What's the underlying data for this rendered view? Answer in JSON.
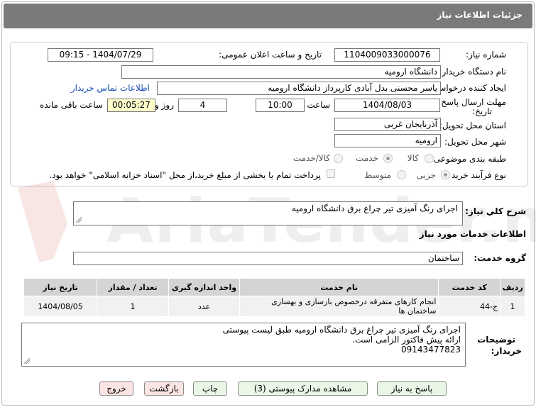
{
  "header": {
    "title": "جزئیات اطلاعات نیاز"
  },
  "form": {
    "need_number_label": "شماره نیاز:",
    "need_number": "1104009033000076",
    "announce_label": "تاریخ و ساعت اعلان عمومی:",
    "announce_value": "1404/07/29 - 09:15",
    "buyer_org_label": "نام دستگاه خریدار:",
    "buyer_org": "دانشگاه ارومیه",
    "creator_label": "ایجاد کننده درخواست:",
    "creator": "یاسر محسنی بدل آبادی کارپرداز دانشگاه ارومیه",
    "contact_link": "اطلاعات تماس خریدار",
    "deadline_label_1": "مهلت ارسال پاسخ: تا",
    "deadline_label_2": "تاریخ:",
    "deadline_date": "1404/08/03",
    "time_label": "ساعت",
    "deadline_time": "10:00",
    "days": "4",
    "days_label": "روز و",
    "remaining": "00:05:27",
    "remaining_label": "ساعت باقی مانده",
    "province_label": "استان محل تحویل:",
    "province": "آذربایجان غربی",
    "city_label": "شهر محل تحویل:",
    "city": "ارومیه",
    "category_label": "طبقه بندی موضوعی:",
    "category_options": [
      "کالا",
      "خدمت",
      "کالا/خدمت"
    ],
    "category_selected": "خدمت",
    "process_label": "نوع فرآیند خرید :",
    "process_options": [
      "جزیی",
      "متوسط"
    ],
    "process_selected": "جزیی",
    "payment_note": "پرداخت تمام یا بخشی از مبلغ خرید،از محل \"اسناد خزانه اسلامی\" خواهد بود."
  },
  "summary": {
    "label": "شرح كلي نياز:",
    "value": "اجرای رنگ آمیزی تیر چراغ برق دانشگاه ارومیه"
  },
  "services": {
    "section_title": "اطلاعات خدمات مورد نیاز",
    "group_label": "گروه خدمت:",
    "group_value": "ساختمان",
    "columns": [
      "ردیف",
      "کد خدمت",
      "نام خدمت",
      "واحد اندازه گیری",
      "تعداد / مقدار",
      "تاریخ نیاز"
    ],
    "rows": [
      {
        "row": "1",
        "code": "ج-44",
        "name": "انجام کارهای متفرقه درخصوص بازسازی و بهسازی ساختمان ها",
        "unit": "عدد",
        "qty": "1",
        "date": "1404/08/05"
      }
    ]
  },
  "notes": {
    "label_1": "توضیحات",
    "label_2": "خریدار:",
    "line1": "اجرای رنگ آمیزی تیر چراغ برق دانشگاه ارومیه طبق لیست پیوستی",
    "line2": "ارائه پیش فاکتور الزامی است.",
    "line3": "09143477823"
  },
  "buttons": {
    "reply": "پاسخ به نیاز",
    "attachments": "مشاهده مدارک پیوستی (3)",
    "print": "چاپ",
    "back": "بازگشت",
    "exit": "خروج"
  },
  "watermark": {
    "text": "AriaTender.neT"
  },
  "colors": {
    "titlebar": "#7a7a7a",
    "link": "#1a4fb3",
    "remaining_bg": "#ffffcc",
    "btn_green": "#eaf7e6",
    "btn_pink": "#fbe4e4"
  }
}
